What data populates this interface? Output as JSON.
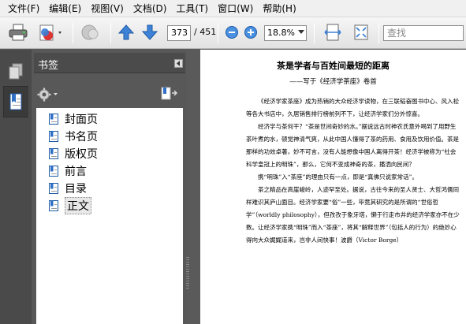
{
  "menu": {
    "items": [
      "文件(F)",
      "编辑(E)",
      "视图(V)",
      "文档(D)",
      "工具(T)",
      "窗口(W)",
      "帮助(H)"
    ]
  },
  "toolbar": {
    "current_page": "373",
    "total_pages": "/ 451",
    "zoom": "18.8%",
    "search_placeholder": "查找"
  },
  "bookmarks": {
    "title": "书签",
    "items": [
      {
        "label": "封面页"
      },
      {
        "label": "书名页"
      },
      {
        "label": "版权页"
      },
      {
        "label": "前言"
      },
      {
        "label": "目录"
      },
      {
        "label": "正文"
      }
    ],
    "selected_index": 5
  },
  "document": {
    "title": "茶是学者与百姓间最短的距离",
    "subtitle": "——写于《经济学茶座》卷首",
    "paragraphs": [
      "《经济学家茶座》成为热销的大众经济学读物，在三联韬奋图书中心、风入松等各大书店中，久居销售排行榜前列不下，让经济学家们分外惊喜。",
      "经济学与茶何干？“茶是世间奇妙的水。”据说远古时神农氏意外喝到了用野生茶叶煮的水，顿觉神清气爽，从此中国人懂得了茶的药用、食用及饮用价值。茶是那样的功效卓著，妙不可言，没有人能想像中国人离得开茶！经济学被称为“社会科学皇冠上的明珠”，那么，它何不变成神奇的茶，播洒向民间？",
      "携“明珠”入“茶座”的理由只有一点，即是“真佛只说家常话”。",
      "茶之精品在高崖峻岭，人迹罕至处。据说，古往今来的圣人贤士、大哲鸿儒同样难识其庐山面目。经济学家要“俗”一些，毕竟其研究的是所谓的“世俗哲学”（worldly philosophy），但孜孜于象牙塔，懒于行走市井的经济学家亦不在少数。让经济学家携“明珠”而入“茶座”，将其“解释世界”（包括人的行为）的绝妙心得向大众娓娓道来，岂非人间快事！波爵（Victor Borge）"
    ]
  }
}
